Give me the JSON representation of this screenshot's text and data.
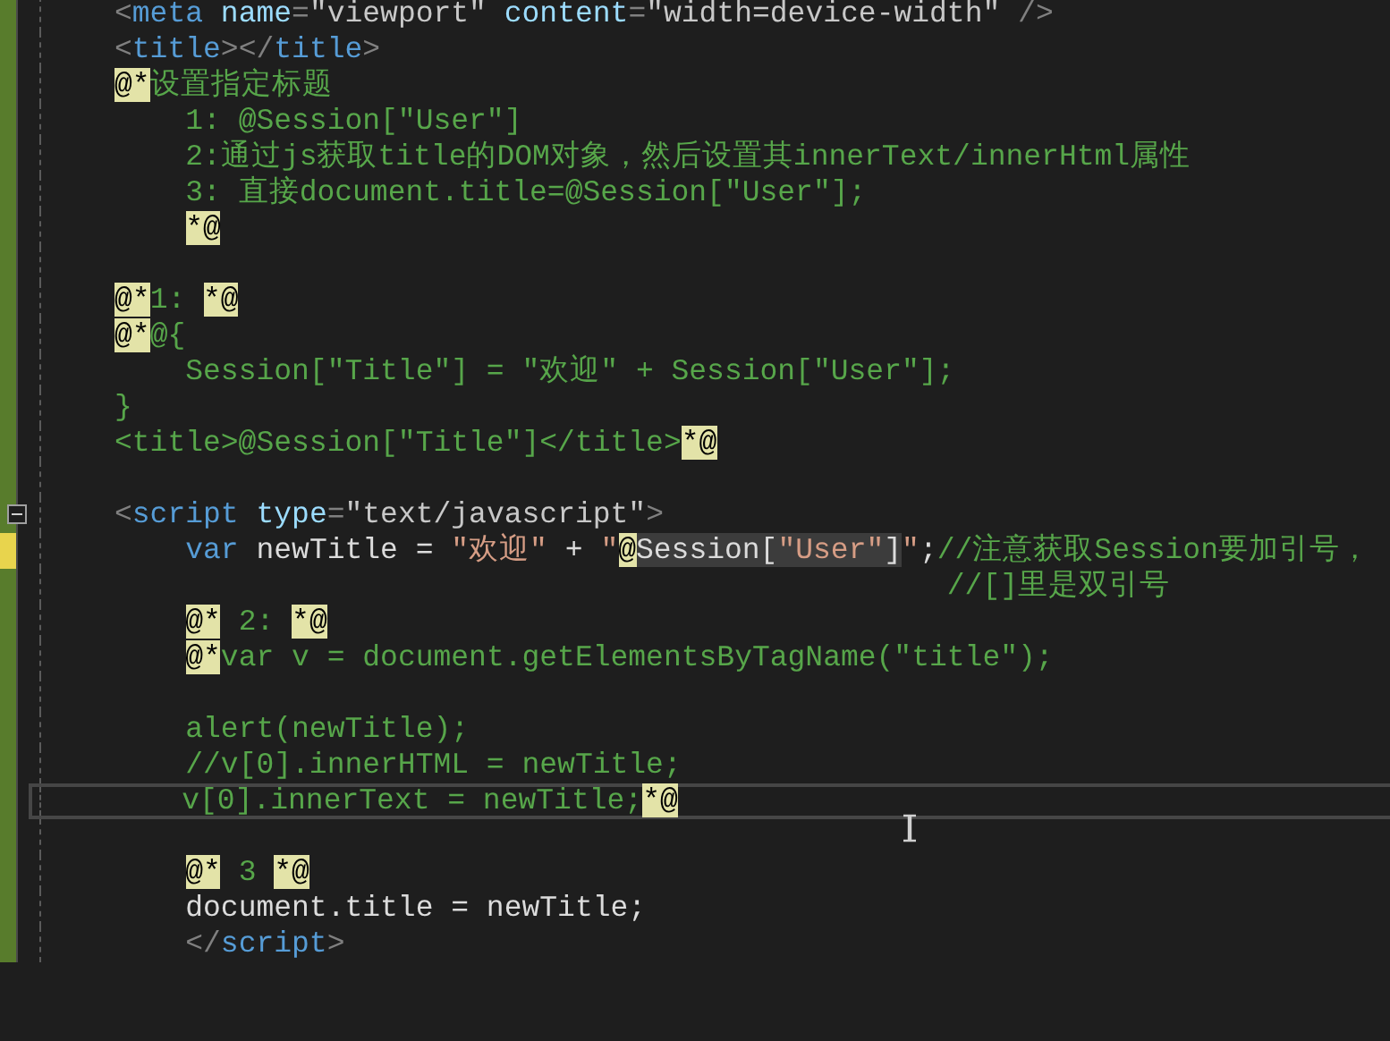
{
  "editor": {
    "lines": [
      {
        "unsaved": false,
        "current": false,
        "tokens": [
          {
            "kind": "punct",
            "text": "<"
          },
          {
            "kind": "tag",
            "text": "meta"
          },
          {
            "kind": "attr",
            "text": " name"
          },
          {
            "kind": "punct",
            "text": "="
          },
          {
            "kind": "value",
            "text": "\"viewport\""
          },
          {
            "kind": "attr",
            "text": " content"
          },
          {
            "kind": "punct",
            "text": "="
          },
          {
            "kind": "value",
            "text": "\"width=device-width\""
          },
          {
            "kind": "punct",
            "text": " />"
          }
        ]
      },
      {
        "unsaved": false,
        "current": false,
        "tokens": [
          {
            "kind": "punct",
            "text": "<"
          },
          {
            "kind": "tag",
            "text": "title"
          },
          {
            "kind": "punct",
            "text": "></"
          },
          {
            "kind": "tag",
            "text": "title"
          },
          {
            "kind": "punct",
            "text": ">"
          }
        ]
      },
      {
        "unsaved": false,
        "current": false,
        "tokens": [
          {
            "kind": "razor",
            "text": "@*"
          },
          {
            "kind": "comment",
            "text": "设置指定标题"
          }
        ]
      },
      {
        "unsaved": false,
        "current": false,
        "tokens": [
          {
            "kind": "comment",
            "text": "    1: @Session[\"User\"]"
          }
        ]
      },
      {
        "unsaved": false,
        "current": false,
        "tokens": [
          {
            "kind": "comment",
            "text": "    2:通过js获取title的DOM对象，然后设置其innerText/innerHtml属性"
          }
        ]
      },
      {
        "unsaved": false,
        "current": false,
        "tokens": [
          {
            "kind": "comment",
            "text": "    3: 直接document.title=@Session[\"User\"];"
          }
        ]
      },
      {
        "unsaved": false,
        "current": false,
        "tokens": [
          {
            "kind": "razor",
            "text": "    *@"
          }
        ]
      },
      {
        "unsaved": false,
        "current": false
      },
      {
        "unsaved": false,
        "current": false,
        "tokens": [
          {
            "kind": "razor",
            "text": "@*"
          },
          {
            "kind": "comment",
            "text": "1: "
          },
          {
            "kind": "razor",
            "text": "*@"
          }
        ]
      },
      {
        "unsaved": false,
        "current": false,
        "tokens": [
          {
            "kind": "razor",
            "text": "@*"
          },
          {
            "kind": "comment",
            "text": "@{"
          }
        ]
      },
      {
        "unsaved": false,
        "current": false,
        "tokens": [
          {
            "kind": "comment",
            "text": "    Session[\"Title\"] = \"欢迎\" + Session[\"User\"];"
          }
        ]
      },
      {
        "unsaved": false,
        "current": false,
        "tokens": [
          {
            "kind": "comment",
            "text": "}"
          }
        ]
      },
      {
        "unsaved": false,
        "current": false,
        "tokens": [
          {
            "kind": "comment",
            "text": "<title>@Session[\"Title\"]</title>"
          },
          {
            "kind": "razor",
            "text": "*@"
          }
        ]
      },
      {
        "unsaved": false,
        "current": false
      },
      {
        "unsaved": false,
        "current": false,
        "fold": {
          "expanded": true
        },
        "tokens": [
          {
            "kind": "punct",
            "text": "<"
          },
          {
            "kind": "tag",
            "text": "script"
          },
          {
            "kind": "attr",
            "text": " type"
          },
          {
            "kind": "punct",
            "text": "="
          },
          {
            "kind": "value",
            "text": "\"text/javascript\""
          },
          {
            "kind": "punct",
            "text": ">"
          }
        ]
      },
      {
        "unsaved": true,
        "current": false,
        "tokens": [
          {
            "kind": "keyword",
            "text": "    var"
          },
          {
            "kind": "text",
            "text": " newTitle = "
          },
          {
            "kind": "string",
            "text": "\"欢迎\""
          },
          {
            "kind": "text",
            "text": " + "
          },
          {
            "kind": "string",
            "text": "\""
          },
          {
            "kind": "razor",
            "text": "@"
          },
          {
            "kind": "ref",
            "text": "Session["
          },
          {
            "kind": "ref-string",
            "text": "\"User\""
          },
          {
            "kind": "ref",
            "text": "]"
          },
          {
            "kind": "string",
            "text": "\""
          },
          {
            "kind": "text",
            "text": ";"
          },
          {
            "kind": "comment",
            "text": "//注意获取Session要加引号，"
          }
        ]
      },
      {
        "unsaved": false,
        "current": false,
        "tokens": [
          {
            "kind": "comment",
            "text": "                                               //[]里是双引号"
          }
        ]
      },
      {
        "unsaved": false,
        "current": false,
        "tokens": [
          {
            "kind": "razor",
            "text": "    @*"
          },
          {
            "kind": "comment",
            "text": " 2: "
          },
          {
            "kind": "razor",
            "text": "*@"
          }
        ]
      },
      {
        "unsaved": false,
        "current": false,
        "tokens": [
          {
            "kind": "razor",
            "text": "    @*"
          },
          {
            "kind": "comment",
            "text": "var v = document.getElementsByTagName(\"title\");"
          }
        ]
      },
      {
        "unsaved": false,
        "current": false
      },
      {
        "unsaved": false,
        "current": false,
        "tokens": [
          {
            "kind": "comment",
            "text": "    alert(newTitle);"
          }
        ]
      },
      {
        "unsaved": false,
        "current": false,
        "tokens": [
          {
            "kind": "comment",
            "text": "    //v[0].innerHTML = newTitle;"
          }
        ]
      },
      {
        "unsaved": false,
        "current": true,
        "tokens": [
          {
            "kind": "comment",
            "text": "    v[0].innerText = newTitle;"
          },
          {
            "kind": "razor",
            "text": "*@"
          }
        ]
      },
      {
        "unsaved": false,
        "current": false
      },
      {
        "unsaved": false,
        "current": false,
        "tokens": [
          {
            "kind": "razor",
            "text": "    @*"
          },
          {
            "kind": "comment",
            "text": " 3 "
          },
          {
            "kind": "razor",
            "text": "*@"
          }
        ]
      },
      {
        "unsaved": false,
        "current": false,
        "tokens": [
          {
            "kind": "text",
            "text": "    document.title = newTitle;"
          }
        ]
      },
      {
        "unsaved": false,
        "current": false,
        "tokens": [
          {
            "kind": "punct",
            "text": "    </"
          },
          {
            "kind": "tag",
            "text": "script"
          },
          {
            "kind": "punct",
            "text": ">"
          }
        ]
      }
    ]
  }
}
